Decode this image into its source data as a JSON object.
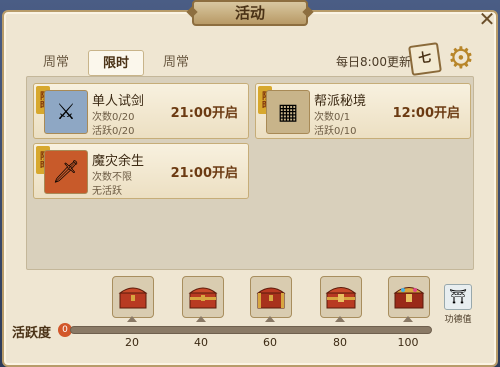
{
  "window": {
    "title": "活动"
  },
  "tabs": [
    {
      "label": "周常",
      "active": false
    },
    {
      "label": "限时",
      "active": true
    },
    {
      "label": "周常",
      "active": false
    }
  ],
  "refresh_text": "每日8:00更新",
  "calendar_glyph": "七",
  "ribbon_text": "限时",
  "activities": [
    {
      "name": "单人试剑",
      "line1": "次数0/20",
      "line2": "活跃0/20",
      "time": "21:00开启",
      "icon": "crossed-swords-icon"
    },
    {
      "name": "帮派秘境",
      "line1": "次数0/1",
      "line2": "活跃0/10",
      "time": "12:00开启",
      "icon": "map-scroll-icon"
    },
    {
      "name": "魔灾余生",
      "line1": "次数不限",
      "line2": "无活跃",
      "time": "21:00开启",
      "icon": "flame-sword-icon"
    }
  ],
  "activity": {
    "label": "活跃度",
    "current": "0",
    "progress": 0,
    "milestones": [
      "20",
      "40",
      "60",
      "80",
      "100"
    ]
  },
  "merit": {
    "label": "功德值"
  },
  "colors": {
    "chest_red": "#b83a22",
    "chest_gold": "#d8a640",
    "accent": "#6b3a12"
  }
}
